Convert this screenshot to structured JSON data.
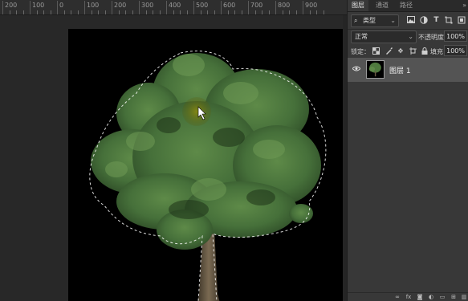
{
  "ruler": {
    "labels": [
      "200",
      "100",
      "0",
      "100",
      "200",
      "300",
      "400",
      "500",
      "600",
      "700",
      "800",
      "900"
    ]
  },
  "canvas": {
    "background": "#000000",
    "content": "tree-with-selection"
  },
  "panel": {
    "tabs": [
      {
        "label": "图层",
        "active": true
      },
      {
        "label": "通道",
        "active": false
      },
      {
        "label": "路径",
        "active": false
      }
    ],
    "collapse_glyph": "»",
    "filter": {
      "glyph": "⌕",
      "label": "类型",
      "chevron": "⌄",
      "icons": [
        "image-filter-icon",
        "adjustment-filter-icon",
        "type-filter-icon",
        "shape-filter-icon",
        "smart-object-filter-icon"
      ]
    },
    "blend": {
      "mode": "正常",
      "chevron": "⌄",
      "opacity_label": "不透明度：",
      "opacity_value": "100%"
    },
    "lock": {
      "label": "锁定：",
      "fill_label": "填充：",
      "fill_value": "100%"
    },
    "layers": [
      {
        "name": "图层 1",
        "visible": true,
        "selected": true
      }
    ],
    "footer_icons": [
      "link-icon",
      "fx-icon",
      "mask-icon",
      "adjustment-icon",
      "group-icon",
      "new-layer-icon",
      "trash-icon"
    ]
  },
  "colors": {
    "panel_bg": "#383838",
    "selected_layer": "#545454",
    "workspace": "#282828",
    "foliage": "#4f7a3e"
  }
}
